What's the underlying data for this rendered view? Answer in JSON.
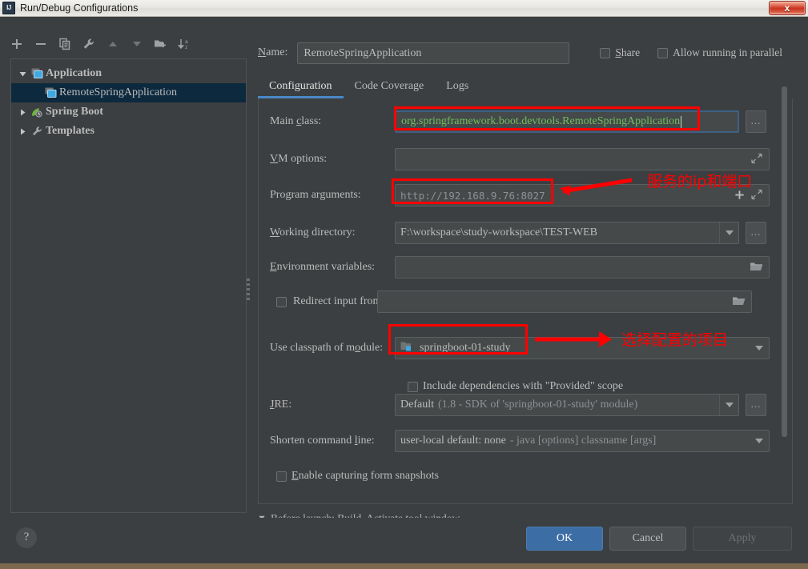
{
  "window": {
    "title": "Run/Debug Configurations",
    "app_icon": "IJ",
    "close_label": "x"
  },
  "toolbar": {
    "items": [
      {
        "name": "add-icon",
        "label": "+"
      },
      {
        "name": "remove-icon",
        "label": "−"
      },
      {
        "name": "copy-icon",
        "label": "Copy Configuration"
      },
      {
        "name": "wrench-icon",
        "label": "Edit Templates"
      },
      {
        "name": "move-up-icon",
        "label": "Move Up"
      },
      {
        "name": "move-down-icon",
        "label": "Move Down"
      },
      {
        "name": "new-folder-icon",
        "label": "Create New Folder"
      },
      {
        "name": "sort-alphabetically-icon",
        "label": "Sort Configurations"
      }
    ]
  },
  "tree": {
    "items": [
      {
        "label": "Application",
        "icon": "application-icon",
        "expanded": true,
        "level": 0,
        "selected": false,
        "bold": true
      },
      {
        "label": "RemoteSpringApplication",
        "icon": "application-icon",
        "expanded": null,
        "level": 1,
        "selected": true,
        "bold": false
      },
      {
        "label": "Spring Boot",
        "icon": "spring-boot-icon",
        "expanded": false,
        "level": 0,
        "selected": false,
        "bold": true
      },
      {
        "label": "Templates",
        "icon": "wrench-icon",
        "expanded": false,
        "level": 0,
        "selected": false,
        "bold": true
      }
    ]
  },
  "header": {
    "name_label": "Name:",
    "name_value": "RemoteSpringApplication",
    "share_label": "Share",
    "share_checked": false,
    "parallel_label": "Allow running in parallel",
    "parallel_checked": false
  },
  "tabs": [
    {
      "label": "Configuration",
      "active": true
    },
    {
      "label": "Code Coverage",
      "active": false
    },
    {
      "label": "Logs",
      "active": false
    }
  ],
  "form": {
    "main_class_label": "Main class:",
    "main_class_value": "org.springframework.boot.devtools.RemoteSpringApplication",
    "vm_options_label": "VM options:",
    "vm_options_value": "",
    "program_arguments_label": "Program arguments:",
    "program_arguments_value": "http://192.168.9.76:8027",
    "working_directory_label": "Working directory:",
    "working_directory_value": "F:\\workspace\\study-workspace\\TEST-WEB",
    "environment_variables_label": "Environment variables:",
    "environment_variables_value": "",
    "redirect_input_label": "Redirect input from:",
    "redirect_input_checked": false,
    "redirect_input_value": "",
    "classpath_label": "Use classpath of module:",
    "classpath_value": "springboot-01-study",
    "include_provided_label": "Include dependencies with \"Provided\" scope",
    "include_provided_checked": false,
    "jre_label": "JRE:",
    "jre_value_bold": "Default",
    "jre_value_dim": "(1.8 - SDK of 'springboot-01-study' module)",
    "shorten_label": "Shorten command line:",
    "shorten_value_bold": "user-local default: none",
    "shorten_value_dim": "- java [options] classname [args]",
    "snapshots_label": "Enable capturing form snapshots",
    "snapshots_checked": false,
    "ellipsis_label": "..."
  },
  "before_launch": {
    "label": "Before launch: Build, Activate tool window"
  },
  "footer": {
    "help_label": "?",
    "ok_label": "OK",
    "cancel_label": "Cancel",
    "apply_label": "Apply"
  },
  "annotations": [
    {
      "name": "program-arguments-note",
      "text": "服务的ip和端口"
    },
    {
      "name": "classpath-module-note",
      "text": "选择配置的项目"
    }
  ],
  "colors": {
    "accent_blue": "#3c6da5",
    "tab_underline": "#4a88c7",
    "annotation_red": "#ff0000",
    "selection_blue": "#0d293e",
    "green_text": "#6ec05a",
    "panel_bg": "#3c3f41"
  }
}
